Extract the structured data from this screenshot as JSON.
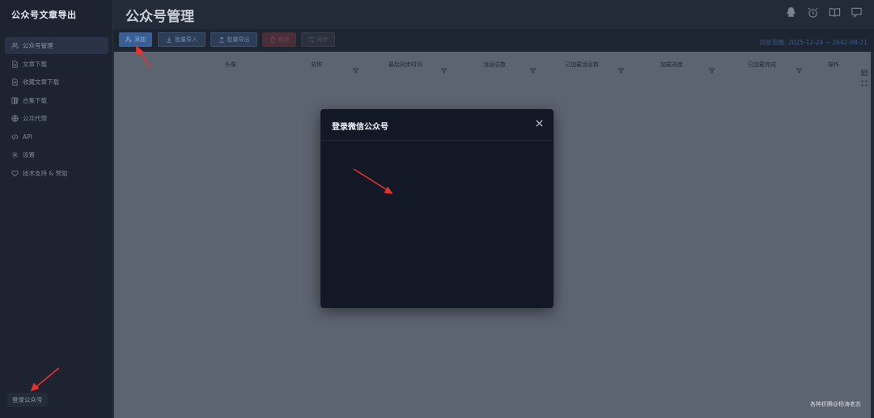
{
  "app": {
    "title": "公众号文章导出"
  },
  "sidebar": {
    "items": [
      {
        "label": "公众号管理",
        "icon": "users-icon",
        "active": true
      },
      {
        "label": "文章下载",
        "icon": "file-download-icon",
        "active": false
      },
      {
        "label": "收藏文章下载",
        "icon": "file-star-icon",
        "active": false
      },
      {
        "label": "合集下载",
        "icon": "collection-icon",
        "active": false
      },
      {
        "label": "公共代理",
        "icon": "globe-icon",
        "active": false
      },
      {
        "label": "API",
        "icon": "api-icon",
        "active": false
      },
      {
        "label": "设置",
        "icon": "gear-icon",
        "active": false
      },
      {
        "label": "技术支持 & 赞助",
        "icon": "heart-handshake-icon",
        "active": false
      }
    ],
    "login_label": "登录公众号"
  },
  "header": {
    "title": "公众号管理",
    "icons": [
      "qq-icon",
      "alarm-clock-icon",
      "book-open-icon",
      "feedback-icon"
    ]
  },
  "toolbar": {
    "add_label": "添加",
    "import_label": "批量导入",
    "export_label": "批量导出",
    "delete_label": "删除",
    "sync_label": "同步",
    "sync_range": "同步范围: 2025-12-24 ~ 2042-08-21"
  },
  "table": {
    "columns": [
      "头像",
      "名称",
      "最后同步时间",
      "消息总数",
      "已加载消息数",
      "加载进度",
      "已加载完成",
      "操作"
    ]
  },
  "modal": {
    "title": "登录微信公众号"
  },
  "watermark": "各种折腾@杨涛老苏",
  "colors": {
    "primary": "#3a5f94",
    "sidebar_bg": "#1d2330",
    "modal_bg": "#121826",
    "arrow": "#e8322a"
  }
}
